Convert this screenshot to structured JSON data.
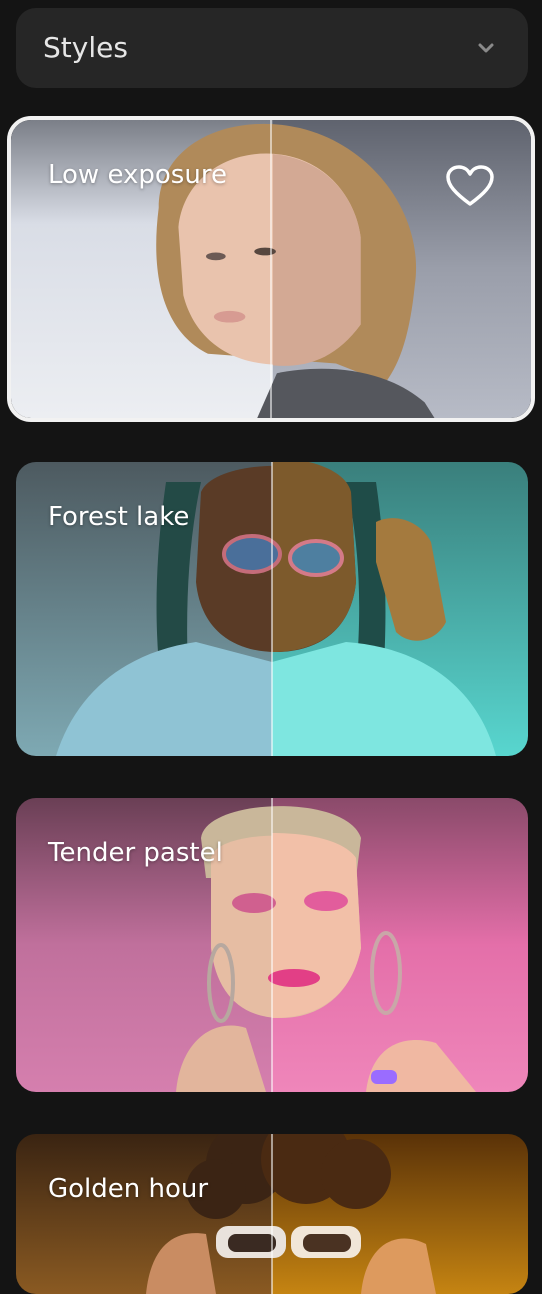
{
  "dropdown": {
    "label": "Styles",
    "icon": "chevron-down-icon"
  },
  "styles": [
    {
      "label": "Low exposure",
      "selected": true,
      "favorite_icon": "heart-icon"
    },
    {
      "label": "Forest lake",
      "selected": false
    },
    {
      "label": "Tender pastel",
      "selected": false
    },
    {
      "label": "Golden hour",
      "selected": false
    }
  ],
  "colors": {
    "background": "#141414",
    "dropdown_bg": "#262626",
    "selected_border": "#f2f2f2",
    "low_exposure": "#c9ccd6",
    "forest_lake": "#3fb4ad",
    "tender_pastel": "#e06aa8",
    "golden_hour": "#b8740f"
  }
}
